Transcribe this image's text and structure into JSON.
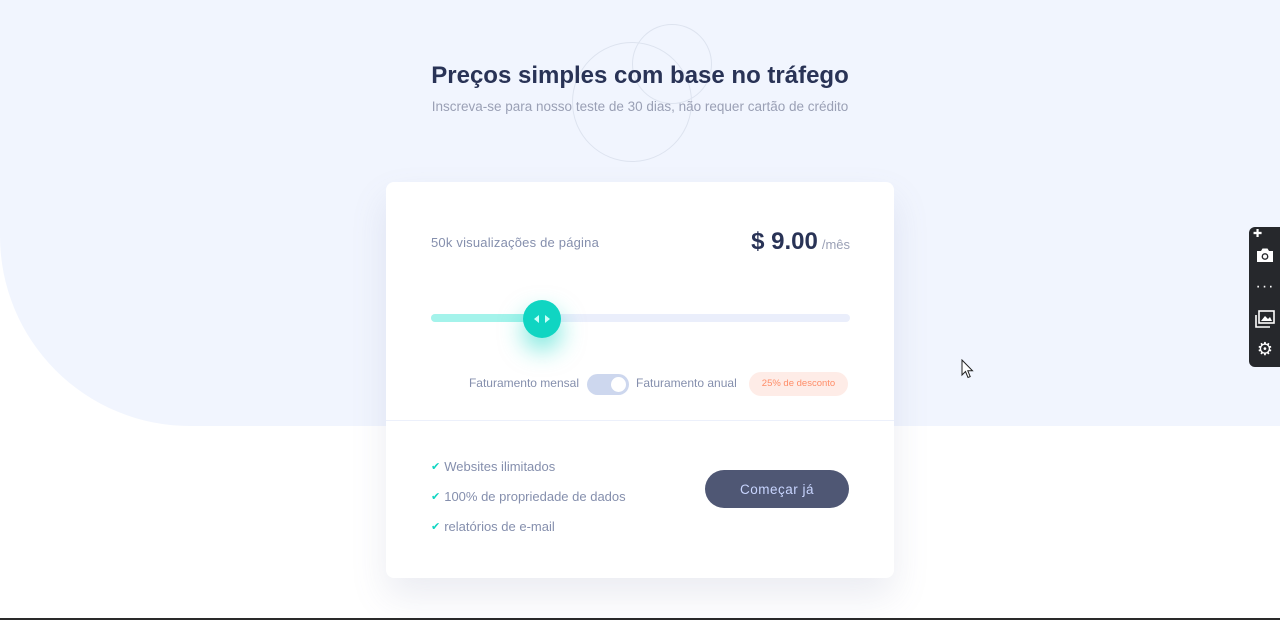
{
  "header": {
    "title": "Preços simples com base no tráfego",
    "subtitle": "Inscreva-se para nosso teste de 30 dias, não requer cartão de crédito"
  },
  "pricing": {
    "pageviews_label": "50k visualizações de página",
    "price": "$ 9.00",
    "period": "/mês",
    "slider_percent": 26.5
  },
  "billing": {
    "monthly_label": "Faturamento mensal",
    "annual_label": "Faturamento anual",
    "discount_badge": "25% de desconto"
  },
  "features": [
    "Websites ilimitados",
    "100% de propriedade de dados",
    "relatórios de e-mail"
  ],
  "cta": {
    "label": "Começar já"
  },
  "colors": {
    "accent": "#10d5c2",
    "accent_light": "#a4f3eb",
    "dark": "#293356",
    "discount_text": "#ff8d68",
    "discount_bg": "#feece7",
    "background": "#f1f5fe"
  },
  "icons": {
    "check": "check-icon",
    "slider_thumb": "slider-arrows-icon",
    "sidebar": [
      "plus-icon",
      "camera-icon",
      "more-icon",
      "gallery-icon",
      "gear-icon"
    ]
  }
}
